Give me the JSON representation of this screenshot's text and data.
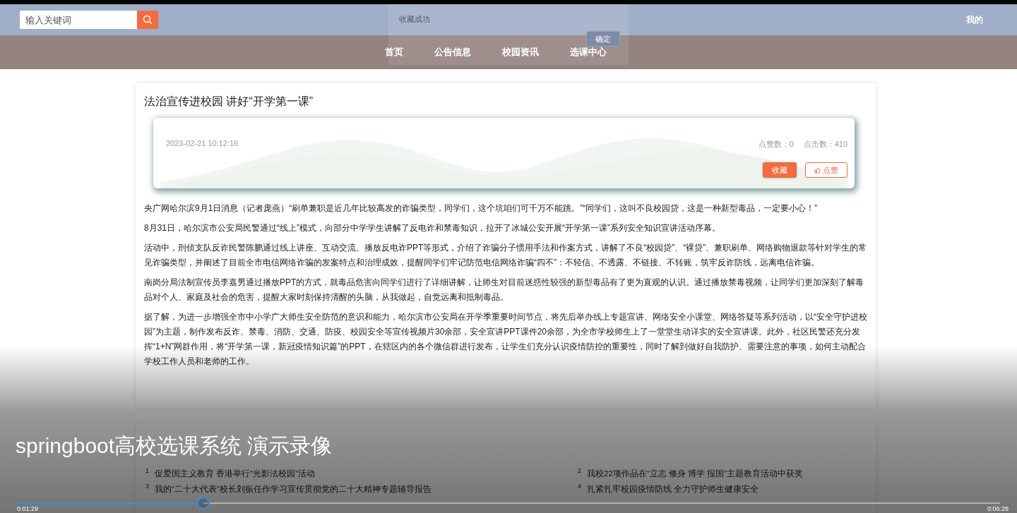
{
  "search": {
    "placeholder": "输入关键词"
  },
  "user_menu": {
    "label": "我的"
  },
  "toast": {
    "message": "收藏成功",
    "button": "确定"
  },
  "nav": [
    {
      "label": "首页"
    },
    {
      "label": "公告信息"
    },
    {
      "label": "校园资讯"
    },
    {
      "label": "选课中心"
    }
  ],
  "article": {
    "title": "法治宣传进校园 讲好“开学第一课”",
    "date": "2023-02-21 10:12:16",
    "likes": "点赞数：0",
    "clicks": "点击数：410",
    "buttons": [
      {
        "label": "收藏",
        "kind": "primary"
      },
      {
        "label": "点赞",
        "kind": "like"
      }
    ],
    "paragraphs": [
      "央广网哈尔滨9月1日消息（记者庞燕）“刷单兼职是近几年比较高发的诈骗类型，同学们，这个坑咱们可千万不能跳。”“同学们，这叫不良校园贷，这是一种新型毒品，一定要小心！”",
      "8月31日，哈尔滨市公安局民警通过“线上”模式，向部分中学学生讲解了反电诈和禁毒知识，拉开了冰城公安开展“开学第一课”系列安全知识宣讲活动序幕。",
      "活动中，刑侦支队反诈民警陈鹏通过线上讲座、互动交流、播放反电诈PPT等形式，介绍了诈骗分子惯用手法和作案方式，讲解了不良“校园贷”、“裸贷”、兼职刷单、网络购物退款等针对学生的常见诈骗类型，并阐述了目前全市电信网络诈骗的发案特点和治理成效，提醒同学们牢记防范电信网络诈骗“四不”：不轻信、不透露、不链接、不转账，筑牢反诈防线，远离电信诈骗。",
      "南岗分局法制宣传员李嘉男通过播放PPT的方式，就毒品危害向同学们进行了详细讲解，让师生对目前迷惑性较强的新型毒品有了更为直观的认识。通过播放禁毒视频，让同学们更加深刻了解毒品对个人、家庭及社会的危害，提醒大家时刻保持清醒的头脑，从我做起，自觉远离和抵制毒品。",
      "据了解，为进一步增强全市中小学广大师生安全防范的意识和能力，哈尔滨市公安局在开学季重要时间节点，将先后举办线上专题宣讲、网络安全小课堂、网络答疑等系列活动，以“安全守护进校园”为主题，制作发布反诈、禁毒、消防、交通、防疫、校园安全等宣传视频片30余部，安全宣讲PPT课件20余部，为全市学校师生上了一堂堂生动详实的安全宣讲课。此外，社区民警还充分发挥“1+N”网群作用，将“开学第一课，新冠疫情知识篇”的PPT，在辖区内的各个微信群进行发布，让学生们充分认识疫情防控的重要性，同时了解到做好自我防护、需要注意的事项，如何主动配合学校工作人员和老师的工作。"
    ]
  },
  "news": [
    {
      "index": "1",
      "title": "促爱国主义教育 香港举行“光影法校园”活动"
    },
    {
      "index": "2",
      "title": "我校22项作品在“立志 修身 博学 报国”主题教育活动中获奖"
    },
    {
      "index": "3",
      "title": "我的“二十大代表”校长刘振任作学习宣传贯彻党的二十大精神专题辅导报告"
    },
    {
      "index": "4",
      "title": "扎紧扎牢校园疫情防线 全力守护师生健康安全"
    }
  ],
  "player": {
    "title": "springboot高校选课系统 演示录像",
    "level": 0.19,
    "elapsed": "0:01:29",
    "duration": "0:06:28"
  }
}
